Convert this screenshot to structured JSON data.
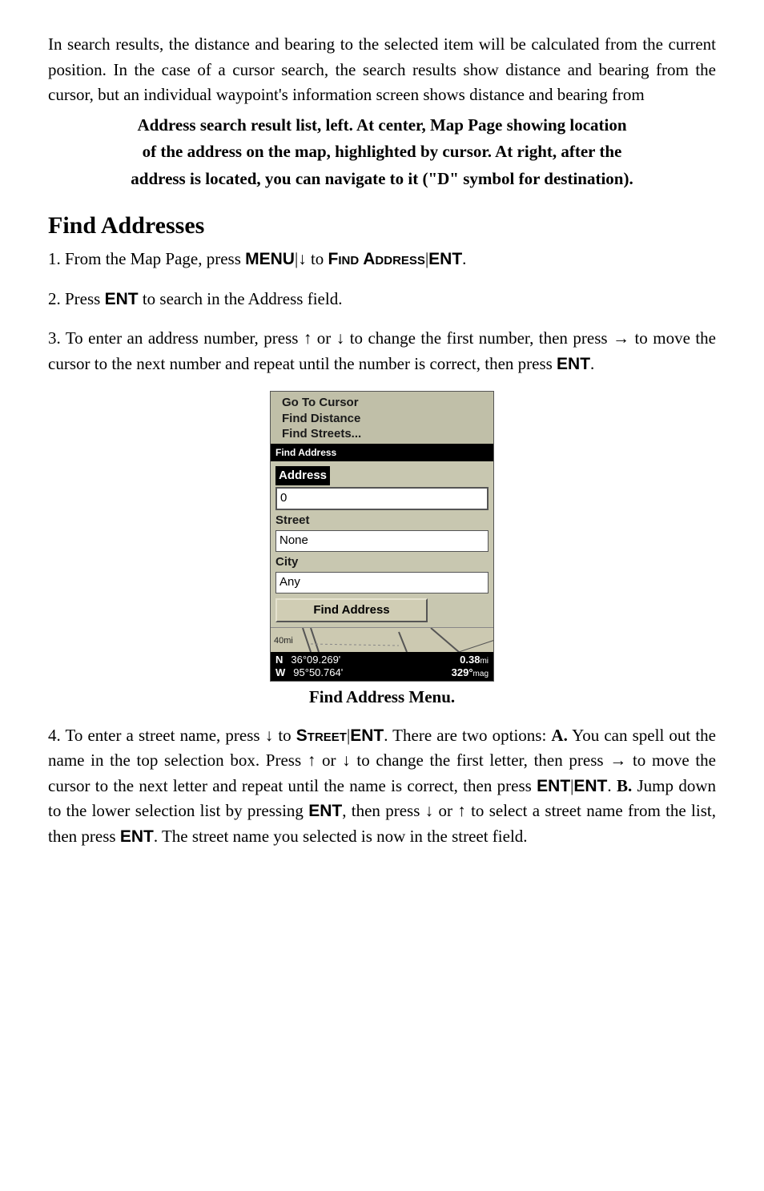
{
  "intro": {
    "p1": "In search results, the distance and bearing to the selected item will be calculated from the current position. In the case of a cursor search, the search results show distance and bearing from the cursor, but an individual waypoint's information screen shows distance and bearing from",
    "caption_line1": "Address search result list, left. At center, Map Page showing location",
    "caption_line2": "of the address on the map, highlighted by cursor. At right, after the",
    "caption_line3": "address is located, you can navigate to it (\"D\" symbol for destination)."
  },
  "heading": "Find Addresses",
  "steps": {
    "s1_a": "1. From the Map Page, press ",
    "s1_menu": "MENU",
    "s1_pipe1": "|",
    "s1_arrow": "↓",
    "s1_to": " to ",
    "s1_find": "Find Address",
    "s1_pipe2": "|",
    "s1_ent": "ENT",
    "s1_end": ".",
    "s2_a": "2. Press ",
    "s2_ent": "ENT",
    "s2_b": " to search in the Address field.",
    "s3_a": "3. To enter an address number, press ",
    "s3_up": "↑",
    "s3_or": " or ",
    "s3_down": "↓",
    "s3_b": " to change the first number, then press ",
    "s3_right": "→",
    "s3_c": " to move the cursor to the next number and repeat until the number is correct, then press ",
    "s3_ent": "ENT",
    "s3_end": "."
  },
  "device": {
    "menu1": "Go To Cursor",
    "menu2": "Find Distance",
    "menu3": "Find Streets...",
    "highlight": "Find Address",
    "label_address": "Address",
    "value_address": "0",
    "label_street": "Street",
    "value_street": "None",
    "label_city": "City",
    "value_city": "Any",
    "button": "Find Address",
    "scale": "40mi",
    "lat_dir": "N",
    "lat": "36°09.269'",
    "lon_dir": "W",
    "lon": "95°50.764'",
    "dist": "0.38",
    "dist_unit": "mi",
    "bearing": "329°",
    "bearing_unit": "mag"
  },
  "figcap": "Find Address Menu.",
  "step4": {
    "a": "4. To enter a street name, press ",
    "down": "↓",
    "to": " to ",
    "street": "Street",
    "pipe": "|",
    "ent1": "ENT",
    "b": ". There are two options: ",
    "A": "A.",
    "c": " You can spell out the name in the top selection box. Press ",
    "up": "↑",
    "or": " or ",
    "down2": "↓",
    "d": " to change the first letter, then press ",
    "right": "→",
    "e": " to move the cursor to the next letter and repeat until the name is correct, then press ",
    "ent2": "ENT",
    "pipe2": "|",
    "ent3": "ENT",
    "f": ". ",
    "B": "B.",
    "g": " Jump down to the lower selection list by pressing ",
    "ent4": "ENT",
    "h": ", then press ",
    "down3": "↓",
    "or2": " or ",
    "up2": "↑",
    "i": " to select a street name from the list, then press ",
    "ent5": "ENT",
    "j": ". The street name you selected is now in the street field."
  }
}
